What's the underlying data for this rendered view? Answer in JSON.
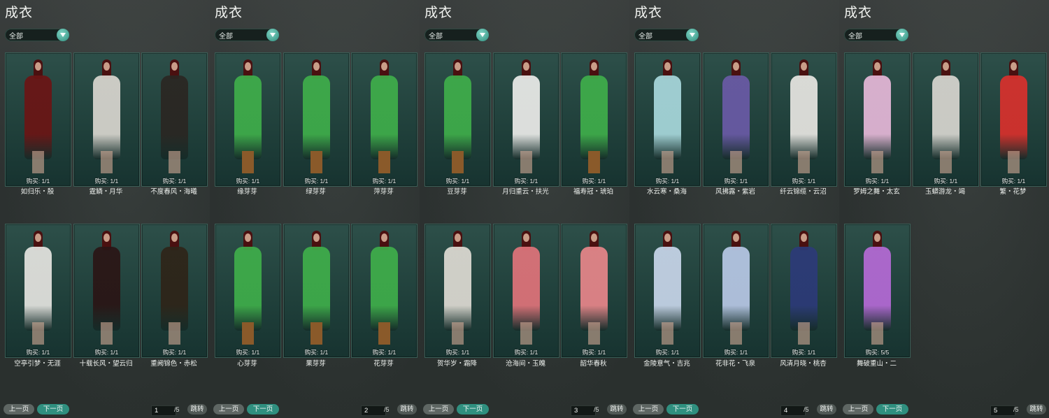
{
  "panels": [
    {
      "title": "成衣",
      "filter": "全部",
      "prev_label": "上一页",
      "next_label": "下一页",
      "page": "1",
      "total": "/5",
      "jump_label": "跳转",
      "items": [
        {
          "name": "如归乐・殷",
          "purchase": "购买: 1/1",
          "color": "#6b1414"
        },
        {
          "name": "霆鳞・月华",
          "purchase": "购买: 1/1",
          "color": "#d9d6cf"
        },
        {
          "name": "不度春风・海曦",
          "purchase": "购买: 1/1",
          "color": "#2a2622"
        },
        {
          "name": "空亭引梦・无涯",
          "purchase": "购买: 1/1",
          "color": "#e5e4e0"
        },
        {
          "name": "十载长风・望云归",
          "purchase": "购买: 1/1",
          "color": "#2a1515"
        },
        {
          "name": "重阙锦色・赤松",
          "purchase": "购买: 1/1",
          "color": "#2e2418"
        }
      ]
    },
    {
      "title": "成衣",
      "filter": "全部",
      "prev_label": "上一页",
      "next_label": "下一页",
      "page": "2",
      "total": "/5",
      "jump_label": "跳转",
      "items": [
        {
          "name": "缘芽芽",
          "purchase": "购买: 1/1",
          "color": "#3fae4a"
        },
        {
          "name": "绿芽芽",
          "purchase": "购买: 1/1",
          "color": "#3fae4a"
        },
        {
          "name": "萍芽芽",
          "purchase": "购买: 1/1",
          "color": "#3fae4a"
        },
        {
          "name": "心芽芽",
          "purchase": "购买: 1/1",
          "color": "#3fae4a"
        },
        {
          "name": "果芽芽",
          "purchase": "购买: 1/1",
          "color": "#3fae4a"
        },
        {
          "name": "花芽芽",
          "purchase": "购买: 1/1",
          "color": "#3fae4a"
        }
      ]
    },
    {
      "title": "成衣",
      "filter": "全部",
      "prev_label": "上一页",
      "next_label": "下一页",
      "page": "3",
      "total": "/5",
      "jump_label": "跳转",
      "items": [
        {
          "name": "豆芽芽",
          "purchase": "购买: 1/1",
          "color": "#3fae4a"
        },
        {
          "name": "月归重云・扶光",
          "purchase": "购买: 1/1",
          "color": "#ececea"
        },
        {
          "name": "福寿冠・琥珀",
          "purchase": "购买: 1/1",
          "color": "#3fae4a"
        },
        {
          "name": "贺华岁・霜降",
          "purchase": "购买: 1/1",
          "color": "#dedbd3"
        },
        {
          "name": "沧海间・玉魄",
          "purchase": "购买: 1/1",
          "color": "#e0737a"
        },
        {
          "name": "韶华春秋",
          "purchase": "购买: 1/1",
          "color": "#e8868a"
        }
      ]
    },
    {
      "title": "成衣",
      "filter": "全部",
      "prev_label": "上一页",
      "next_label": "下一页",
      "page": "4",
      "total": "/5",
      "jump_label": "跳转",
      "items": [
        {
          "name": "水云寒・桑海",
          "purchase": "购买: 1/1",
          "color": "#a8d8dc"
        },
        {
          "name": "风拂露・紫岩",
          "purchase": "购买: 1/1",
          "color": "#6a5aa6"
        },
        {
          "name": "纤云锦缆・云沼",
          "purchase": "购买: 1/1",
          "color": "#e8e6e2"
        },
        {
          "name": "金陵意气・吉兆",
          "purchase": "购买: 1/1",
          "color": "#c8d6ea"
        },
        {
          "name": "花非花・飞泉",
          "purchase": "购买: 1/1",
          "color": "#b8c8e6"
        },
        {
          "name": "风清月晓・桃杏",
          "purchase": "购买: 1/1",
          "color": "#2c3a78"
        }
      ]
    },
    {
      "title": "成衣",
      "filter": "全部",
      "prev_label": "上一页",
      "next_label": "下一页",
      "page": "5",
      "total": "/5",
      "jump_label": "跳转",
      "items": [
        {
          "name": "罗姆之舞・太玄",
          "purchase": "购买: 1/1",
          "color": "#e6b8d8"
        },
        {
          "name": "玉蟒游龙・竭",
          "purchase": "购买: 1/1",
          "color": "#d8d6d0"
        },
        {
          "name": "繁・花梦",
          "purchase": "购买: 1/1",
          "color": "#d9302c"
        },
        {
          "name": "舞破重山・二",
          "purchase": "购买: 5/5",
          "color": "#b56ad6"
        }
      ]
    }
  ]
}
